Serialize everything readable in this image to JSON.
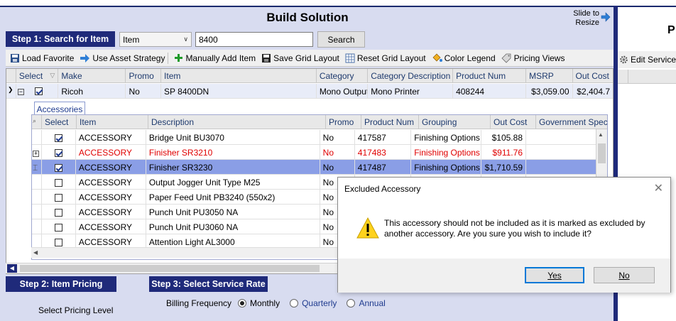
{
  "title": "Build Solution",
  "slide_to_resize": "Slide to Resize",
  "step1": {
    "label": "Step 1: Search for Item",
    "select_value": "Item",
    "search_value": "8400",
    "search_button": "Search"
  },
  "toolbar": [
    "Load Favorite",
    "Use Asset Strategy",
    "Manually Add Item",
    "Save Grid Layout",
    "Reset Grid Layout",
    "Color Legend",
    "Pricing Views"
  ],
  "right_panel": {
    "title_partial": "P",
    "toolbar_item": "Edit Service"
  },
  "main_grid": {
    "headers": [
      "Select",
      "Make",
      "Promo",
      "Item",
      "Category",
      "Category Description",
      "Product Num",
      "MSRP",
      "Out Cost"
    ],
    "row": {
      "make": "Ricoh",
      "promo": "No",
      "item": "SP 8400DN",
      "category": "Mono Output",
      "category_desc": "Mono Printer",
      "product_num": "408244",
      "msrp": "$3,059.00",
      "out_cost": "$2,404.7"
    }
  },
  "accessories": {
    "tab": "Accessories",
    "headers": [
      "Select",
      "Item",
      "Description",
      "Promo",
      "Product Num",
      "Grouping",
      "Out Cost",
      "Government Special"
    ],
    "rows": [
      {
        "checked": true,
        "item": "ACCESSORY",
        "desc": "Bridge Unit BU3070",
        "promo": "No",
        "pn": "417587",
        "grouping": "Finishing Options",
        "cost": "$105.88",
        "style": "normal"
      },
      {
        "checked": true,
        "item": "ACCESSORY",
        "desc": "Finisher SR3210",
        "promo": "No",
        "pn": "417483",
        "grouping": "Finishing Options",
        "cost": "$911.76",
        "style": "red"
      },
      {
        "checked": true,
        "item": "ACCESSORY",
        "desc": "Finisher SR3230",
        "promo": "No",
        "pn": "417487",
        "grouping": "Finishing Options",
        "cost": "$1,710.59",
        "style": "selected"
      },
      {
        "checked": false,
        "item": "ACCESSORY",
        "desc": "Output Jogger Unit Type M25",
        "promo": "No",
        "pn": "",
        "grouping": "",
        "cost": "",
        "style": "normal"
      },
      {
        "checked": false,
        "item": "ACCESSORY",
        "desc": "Paper Feed Unit PB3240 (550x2)",
        "promo": "No",
        "pn": "",
        "grouping": "",
        "cost": "",
        "style": "normal"
      },
      {
        "checked": false,
        "item": "ACCESSORY",
        "desc": "Punch Unit PU3050 NA",
        "promo": "No",
        "pn": "",
        "grouping": "",
        "cost": "",
        "style": "normal"
      },
      {
        "checked": false,
        "item": "ACCESSORY",
        "desc": "Punch Unit PU3060 NA",
        "promo": "No",
        "pn": "",
        "grouping": "",
        "cost": "",
        "style": "normal"
      },
      {
        "checked": false,
        "item": "ACCESSORY",
        "desc": "Attention Light AL3000",
        "promo": "No",
        "pn": "",
        "grouping": "",
        "cost": "",
        "style": "normal"
      }
    ]
  },
  "step2": {
    "label": "Step 2: Item Pricing",
    "sub": "Select Pricing Level"
  },
  "step3": {
    "label": "Step 3: Select Service Rate",
    "billing_label": "Billing Frequency",
    "options": [
      "Monthly",
      "Quarterly",
      "Annual"
    ],
    "selected": "Monthly"
  },
  "dialog": {
    "title": "Excluded Accessory",
    "message": "This accessory should not be included as it is marked as excluded by another accessory. Are you sure you wish to include it?",
    "yes": "Yes",
    "no": "No"
  },
  "colors": {
    "accent": "#1f2a7a",
    "panel": "#d8dcf0",
    "selected_row": "#8a9ee6",
    "red_text": "#e00000"
  }
}
